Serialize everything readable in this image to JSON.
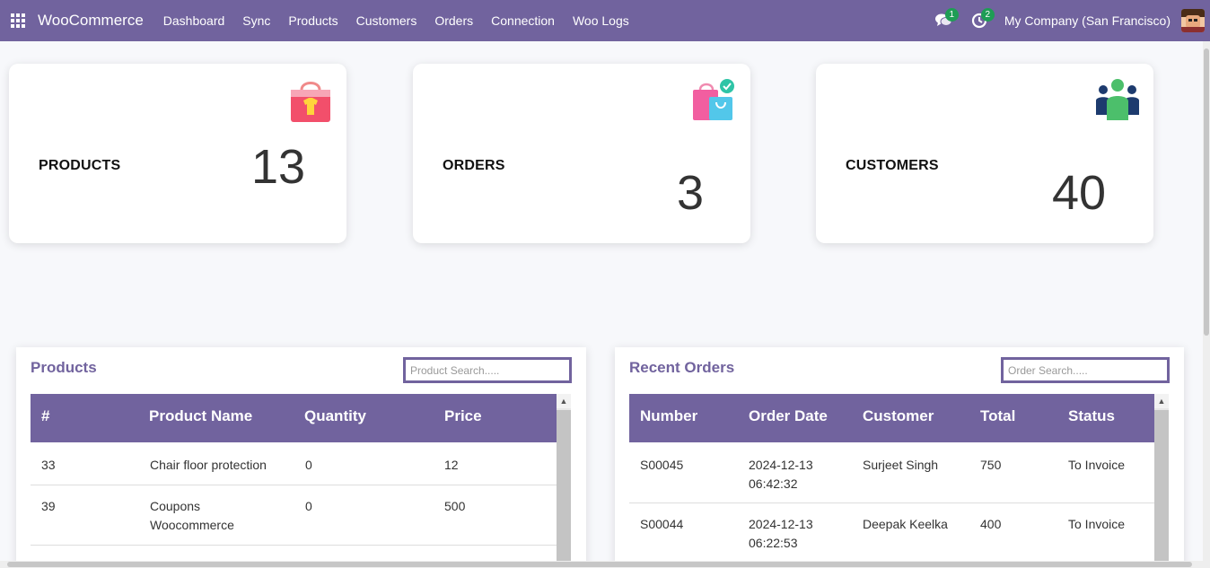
{
  "navbar": {
    "brand": "WooCommerce",
    "menu": [
      "Dashboard",
      "Sync",
      "Products",
      "Customers",
      "Orders",
      "Connection",
      "Woo Logs"
    ],
    "messages_badge": "1",
    "activities_badge": "2",
    "company": "My Company (San Francisco)"
  },
  "cards": {
    "products": {
      "label": "PRODUCTS",
      "value": "13"
    },
    "orders": {
      "label": "ORDERS",
      "value": "3"
    },
    "customers": {
      "label": "CUSTOMERS",
      "value": "40"
    }
  },
  "products_panel": {
    "title": "Products",
    "search_placeholder": "Product Search.....",
    "columns": [
      "#",
      "Product Name",
      "Quantity",
      "Price"
    ],
    "rows": [
      {
        "id": "33",
        "name": "Chair floor protection",
        "name2": "",
        "qty": "0",
        "price": "12"
      },
      {
        "id": "39",
        "name": "Coupons",
        "name2": "Woocommerce",
        "qty": "0",
        "price": "500"
      }
    ]
  },
  "orders_panel": {
    "title": "Recent Orders",
    "search_placeholder": "Order Search.....",
    "columns": [
      "Number",
      "Order Date",
      "Customer",
      "Total",
      "Status"
    ],
    "rows": [
      {
        "number": "S00045",
        "date": "2024-12-13",
        "time": "06:42:32",
        "customer": "Surjeet Singh",
        "total": "750",
        "status": "To Invoice"
      },
      {
        "number": "S00044",
        "date": "2024-12-13",
        "time": "06:22:53",
        "customer": "Deepak Keelka",
        "total": "400",
        "status": "To Invoice"
      }
    ]
  },
  "colors": {
    "primary": "#71639e",
    "badge": "#1f9d55",
    "background": "#f7f8fb"
  }
}
